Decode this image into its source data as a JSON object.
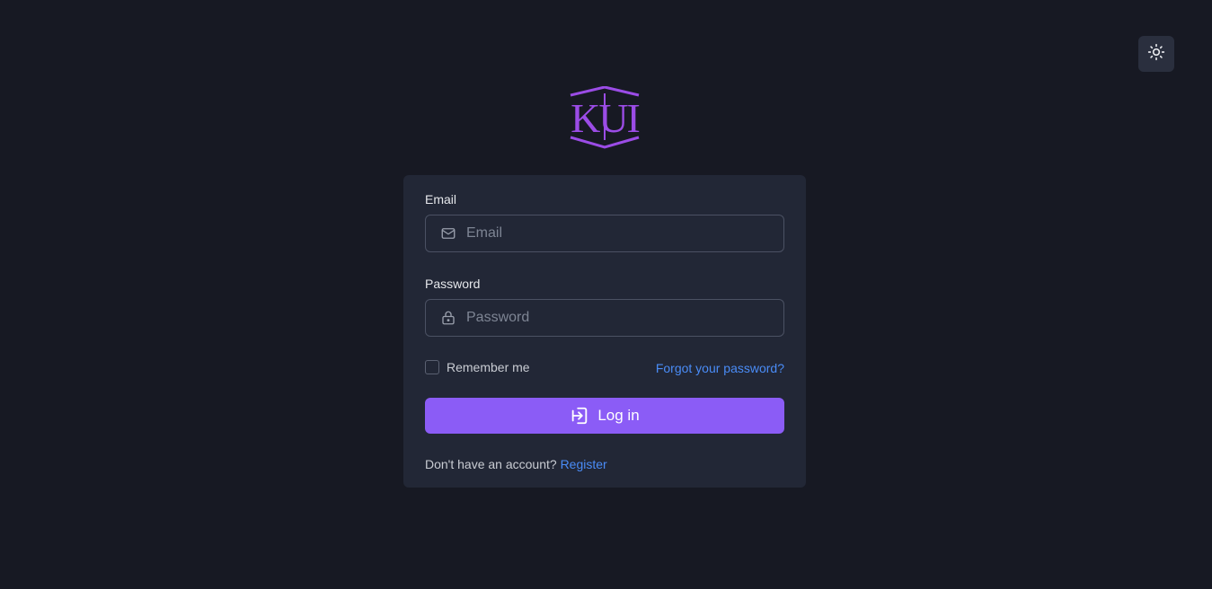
{
  "header": {
    "theme_toggle_icon": "sun-icon",
    "logo_text": "KUI",
    "logo_color": "#9b4ce6"
  },
  "form": {
    "email": {
      "label": "Email",
      "placeholder": "Email",
      "value": "",
      "icon": "mail-icon"
    },
    "password": {
      "label": "Password",
      "placeholder": "Password",
      "value": "",
      "icon": "lock-icon"
    },
    "remember_label": "Remember me",
    "remember_checked": false,
    "forgot_label": "Forgot your password?",
    "login_label": "Log in",
    "login_icon": "login-icon",
    "no_account_text": "Don't have an account?",
    "register_label": "Register"
  },
  "colors": {
    "background": "#171923",
    "card": "#222736",
    "accent": "#8b5cf6",
    "link": "#4a8cf7"
  }
}
